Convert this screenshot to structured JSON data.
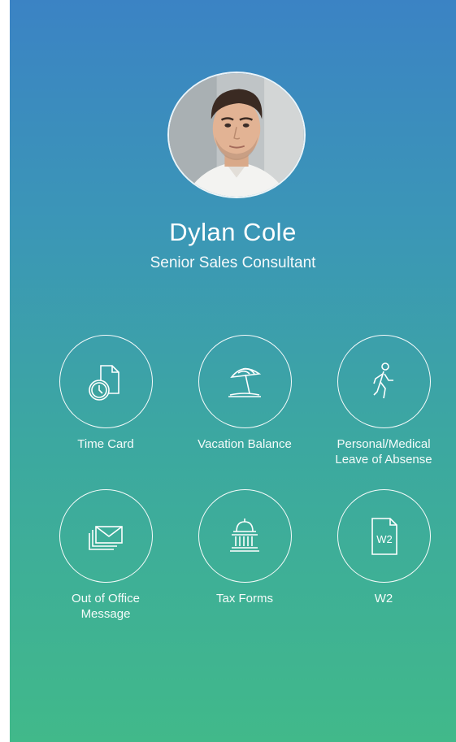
{
  "profile": {
    "name": "Dylan Cole",
    "title": "Senior Sales Consultant"
  },
  "tiles": [
    {
      "label": "Time Card",
      "icon": "time-card-icon"
    },
    {
      "label": "Vacation Balance",
      "icon": "beach-umbrella-icon"
    },
    {
      "label": "Personal/Medical\nLeave of Absense",
      "icon": "walking-person-icon"
    },
    {
      "label": "Out of Office\nMessage",
      "icon": "mail-stack-icon"
    },
    {
      "label": "Tax Forms",
      "icon": "government-building-icon"
    },
    {
      "label": "W2",
      "icon": "w2-document-icon",
      "icon_text": "W2"
    }
  ],
  "colors": {
    "gradient_top": "#3b83c4",
    "gradient_bottom": "#41b98a",
    "text": "#ffffff"
  }
}
